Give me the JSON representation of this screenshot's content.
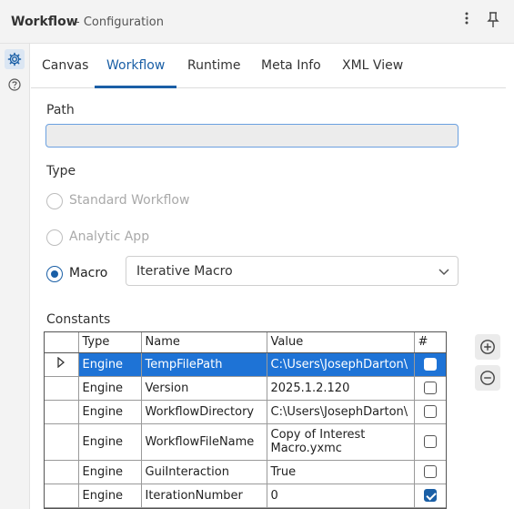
{
  "window": {
    "title": "Workflow",
    "subtitle": "- Configuration",
    "menu_icon": "more-vertical-icon",
    "pin_icon": "pin-icon"
  },
  "left_rail": {
    "items": [
      {
        "icon": "gear-icon"
      },
      {
        "icon": "help-icon"
      }
    ]
  },
  "tabs": [
    {
      "label": "Canvas"
    },
    {
      "label": "Workflow"
    },
    {
      "label": "Runtime"
    },
    {
      "label": "Meta Info"
    },
    {
      "label": "XML View"
    }
  ],
  "active_tab": "Workflow",
  "path": {
    "label": "Path",
    "value": ""
  },
  "type": {
    "label": "Type",
    "options": [
      {
        "label": "Standard Workflow",
        "enabled": false,
        "checked": false
      },
      {
        "label": "Analytic App",
        "enabled": false,
        "checked": false
      },
      {
        "label": "Macro",
        "enabled": true,
        "checked": true
      }
    ],
    "macro_select": {
      "value": "Iterative Macro"
    }
  },
  "constants": {
    "label": "Constants",
    "columns": [
      "Type",
      "Name",
      "Value",
      "#"
    ],
    "rows": [
      {
        "type": "Engine",
        "name": "TempFilePath",
        "value": "C:\\Users\\JosephDarton\\",
        "checked": false,
        "selected": true
      },
      {
        "type": "Engine",
        "name": "Version",
        "value": "2025.1.2.120",
        "checked": false,
        "selected": false
      },
      {
        "type": "Engine",
        "name": "WorkflowDirectory",
        "value": "C:\\Users\\JosephDarton\\",
        "checked": false,
        "selected": false
      },
      {
        "type": "Engine",
        "name": "WorkflowFileName",
        "value": "Copy of Interest Macro.yxmc",
        "checked": false,
        "selected": false
      },
      {
        "type": "Engine",
        "name": "GuiInteraction",
        "value": "True",
        "checked": false,
        "selected": false
      },
      {
        "type": "Engine",
        "name": "IterationNumber",
        "value": "0",
        "checked": true,
        "selected": false
      }
    ],
    "add_icon": "plus-circle-icon",
    "remove_icon": "minus-circle-icon"
  },
  "colors": {
    "accent": "#1a5fa6",
    "selection": "#1e73d6",
    "panel_bg": "#f3f3f3"
  }
}
